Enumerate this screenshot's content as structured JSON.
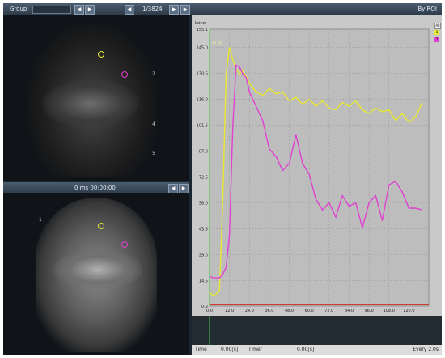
{
  "toolbar": {
    "group_label": "Group",
    "frame_counter": "1/3824",
    "roi_mode": "By ROI"
  },
  "video": {
    "time_readout": "0 ms   00:00:00",
    "depth_scale_labels": [
      "1",
      "2",
      "3",
      "4",
      "5"
    ],
    "roi_colors": {
      "roi_1": "#e6e62e",
      "roi_2": "#e040d0"
    }
  },
  "chart": {
    "y_axis_label": "Level",
    "legend": [
      "All",
      "1",
      "2"
    ],
    "marker_label": "97.35",
    "footer": {
      "time_label": "Time",
      "time_value": "0.00[s]",
      "timer_label": "Timer",
      "timer_value": "0.00[s]",
      "interval": "Every 2.0s"
    }
  },
  "chart_data": {
    "type": "line",
    "ylabel": "Level",
    "xlim": [
      0,
      132
    ],
    "ylim": [
      0.2,
      155.1
    ],
    "yticks": [
      0.2,
      14.5,
      29.0,
      43.5,
      58.0,
      72.5,
      87.0,
      101.5,
      116.0,
      130.5,
      145.0,
      155.1
    ],
    "yticklabels": [
      "0.2",
      "14.5",
      "29.0",
      "43.5",
      "58.0",
      "72.5",
      "87.0",
      "101.5",
      "116.0",
      "130.5",
      "145.0",
      "155.1"
    ],
    "xticks": [
      0,
      12,
      24,
      36,
      48,
      60,
      72,
      84,
      96,
      108,
      120
    ],
    "xticklabels": [
      "0.0",
      "12.0",
      "24.0",
      "36.0",
      "48.0",
      "60.0",
      "72.0",
      "84.0",
      "96.0",
      "108.0",
      "120.0"
    ],
    "series": [
      {
        "name": "1",
        "color": "#e8e82e",
        "x": [
          0,
          2,
          4,
          6,
          8,
          10,
          12,
          14,
          16,
          18,
          20,
          24,
          28,
          32,
          36,
          40,
          44,
          48,
          52,
          56,
          60,
          64,
          68,
          72,
          76,
          80,
          84,
          88,
          92,
          96,
          100,
          104,
          108,
          112,
          116,
          120,
          124,
          128
        ],
        "y": [
          8,
          6,
          7,
          9,
          60,
          130,
          145,
          138,
          133,
          130,
          132,
          125,
          120,
          118,
          122,
          119,
          120,
          115,
          117,
          113,
          116,
          112,
          115,
          111,
          110,
          114,
          112,
          115,
          110,
          108,
          111,
          109,
          110,
          104,
          108,
          103,
          106,
          114
        ]
      },
      {
        "name": "2",
        "color": "#e040d0",
        "x": [
          0,
          2,
          4,
          6,
          8,
          10,
          12,
          14,
          16,
          18,
          20,
          22,
          24,
          28,
          32,
          36,
          40,
          44,
          48,
          52,
          56,
          60,
          64,
          68,
          72,
          76,
          80,
          84,
          88,
          92,
          96,
          100,
          104,
          108,
          112,
          116,
          120,
          124,
          128
        ],
        "y": [
          17,
          16,
          16,
          16,
          18,
          22,
          40,
          100,
          135,
          134,
          130,
          128,
          120,
          112,
          104,
          88,
          84,
          76,
          80,
          96,
          80,
          74,
          60,
          54,
          58,
          50,
          62,
          56,
          58,
          44,
          58,
          62,
          48,
          68,
          70,
          64,
          55,
          55,
          54
        ]
      }
    ]
  }
}
